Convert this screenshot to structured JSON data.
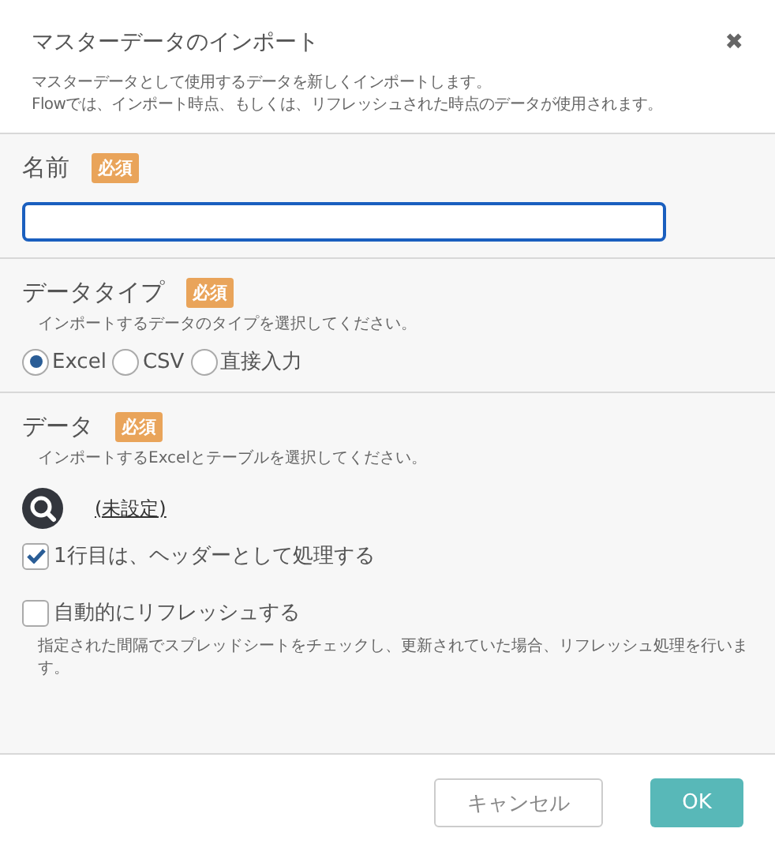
{
  "dialog": {
    "title": "マスターデータのインポート",
    "close": "✖",
    "description": [
      "マスターデータとして使用するデータを新しくインポートします。",
      "Flowでは、インポート時点、もしくは、リフレッシュされた時点のデータが使用されます。"
    ]
  },
  "sections": [
    {
      "kind": "text",
      "label": "名前",
      "badge": "必須",
      "focused": true
    },
    {
      "kind": "radio",
      "label": "データタイプ",
      "badge": "必須",
      "hint": "インポートするデータのタイプを選択してください。",
      "options": [
        {
          "label": "Excel",
          "selected": true
        },
        {
          "label": "CSV",
          "selected": false
        },
        {
          "label": "直接入力",
          "selected": false
        }
      ]
    },
    {
      "kind": "data",
      "label": "データ",
      "badge": "必須",
      "hint": "インポートするExcelとテーブルを選択してください。",
      "link": "(未設定)",
      "checks": [
        {
          "label": "1行目は、ヘッダーとして処理する",
          "checked": true
        },
        {
          "label": "自動的にリフレッシュする",
          "checked": false,
          "note": "指定された間隔でスプレッドシートをチェックし、更新されていた場合、リフレッシュ処理を行います。"
        }
      ]
    }
  ],
  "buttons": [
    {
      "label": "キャンセル",
      "kind": "secondary"
    },
    {
      "label": "OK",
      "kind": "primary"
    }
  ]
}
